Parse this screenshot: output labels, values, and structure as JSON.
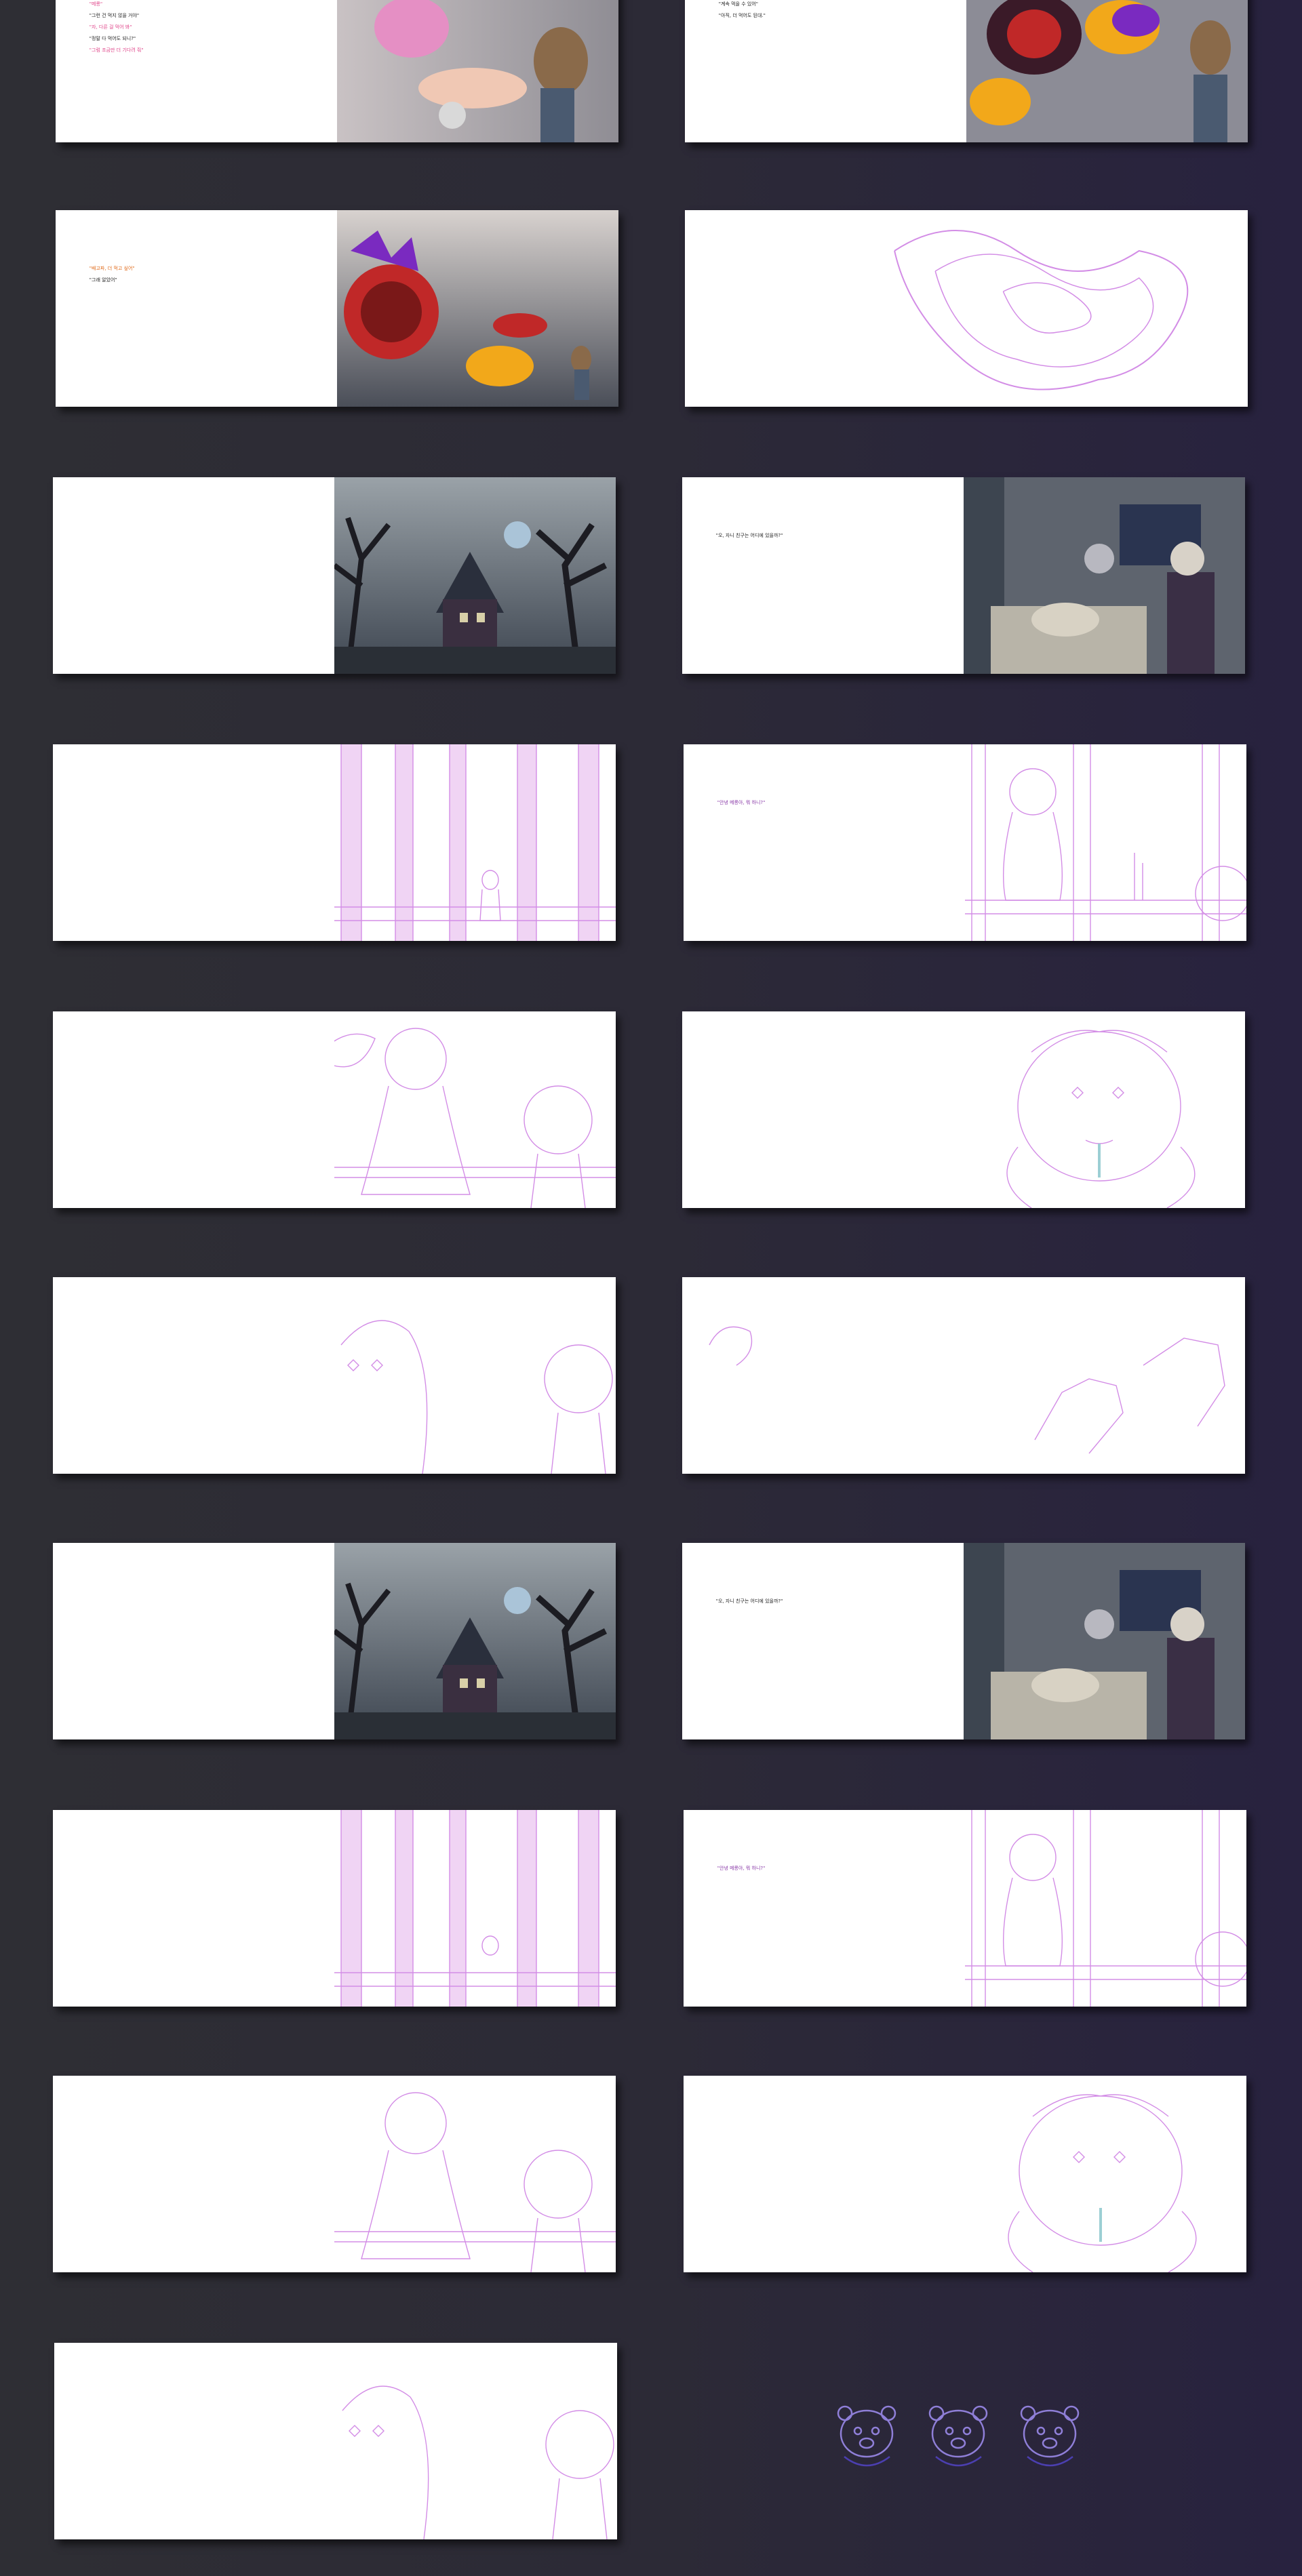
{
  "page": {
    "title": ""
  },
  "spreads": [
    {
      "id": "s01",
      "lines": [
        {
          "t": "\"메롱\"",
          "c": "pink"
        },
        {
          "t": "\"그런 건 먹지 않을 거야\"",
          "c": ""
        },
        {
          "t": "\"자, 다른 걸 먹어 봐\"",
          "c": "pink"
        },
        {
          "t": "",
          "c": ""
        },
        {
          "t": "\"정말 다 먹어도 되니?\"",
          "c": ""
        },
        {
          "t": "\"그럼 조금만 더 기다려 줘\"",
          "c": "pink"
        }
      ]
    },
    {
      "id": "s02",
      "lines": [
        {
          "t": "\"계속 먹을 수 있어\"",
          "c": ""
        },
        {
          "t": "\"아직, 더 먹어도 된대.\"",
          "c": ""
        },
        {
          "t": "",
          "c": ""
        }
      ]
    },
    {
      "id": "s03",
      "lines": [
        {
          "t": "\"배고파, 더 먹고 싶어\"",
          "c": "orange"
        },
        {
          "t": "",
          "c": ""
        },
        {
          "t": "\"그래 알았어\"",
          "c": ""
        }
      ]
    },
    {
      "id": "s04",
      "lines": [
        {
          "t": "",
          "c": ""
        }
      ]
    },
    {
      "id": "s05",
      "lines": [
        {
          "t": "",
          "c": ""
        }
      ]
    },
    {
      "id": "s06",
      "lines": [
        {
          "t": "\"오, 자니 친구는 어디에 있을까?\"",
          "c": ""
        },
        {
          "t": "",
          "c": ""
        },
        {
          "t": "",
          "c": ""
        }
      ]
    },
    {
      "id": "s07",
      "lines": [
        {
          "t": "",
          "c": ""
        }
      ]
    },
    {
      "id": "s08",
      "lines": [
        {
          "t": "\"안녕 메롱아, 뭐 하니?\"",
          "c": "purple"
        },
        {
          "t": "",
          "c": ""
        },
        {
          "t": "",
          "c": "purple"
        },
        {
          "t": "",
          "c": "purple"
        }
      ]
    },
    {
      "id": "s09",
      "lines": [
        {
          "t": "",
          "c": "purple"
        },
        {
          "t": "",
          "c": ""
        },
        {
          "t": "",
          "c": "purple"
        },
        {
          "t": "",
          "c": ""
        }
      ]
    },
    {
      "id": "s10",
      "lines": [
        {
          "t": "",
          "c": "purple"
        }
      ]
    },
    {
      "id": "s11",
      "lines": [
        {
          "t": "",
          "c": ""
        },
        {
          "t": "",
          "c": ""
        },
        {
          "t": "",
          "c": "pink"
        },
        {
          "t": "",
          "c": ""
        },
        {
          "t": "",
          "c": ""
        },
        {
          "t": "",
          "c": "purple"
        },
        {
          "t": "",
          "c": ""
        },
        {
          "t": "",
          "c": ""
        }
      ]
    },
    {
      "id": "s12",
      "lines": [
        {
          "t": "",
          "c": ""
        }
      ]
    },
    {
      "id": "s13",
      "lines": [
        {
          "t": "",
          "c": ""
        }
      ]
    },
    {
      "id": "s14",
      "lines": [
        {
          "t": "\"오, 자니 친구는 어디에 있을까?\"",
          "c": ""
        },
        {
          "t": "",
          "c": ""
        },
        {
          "t": "",
          "c": ""
        }
      ]
    },
    {
      "id": "s15",
      "lines": [
        {
          "t": "",
          "c": ""
        }
      ]
    },
    {
      "id": "s16",
      "lines": [
        {
          "t": "\"안녕 메롱아, 뭐 하니?\"",
          "c": "purple"
        },
        {
          "t": "",
          "c": ""
        },
        {
          "t": "",
          "c": "purple"
        },
        {
          "t": "",
          "c": "purple"
        }
      ]
    },
    {
      "id": "s17",
      "lines": [
        {
          "t": "",
          "c": "purple"
        },
        {
          "t": "",
          "c": ""
        },
        {
          "t": "",
          "c": "purple"
        },
        {
          "t": "",
          "c": ""
        }
      ]
    },
    {
      "id": "s18",
      "lines": [
        {
          "t": "",
          "c": "purple"
        }
      ]
    },
    {
      "id": "s19",
      "lines": [
        {
          "t": "",
          "c": ""
        },
        {
          "t": "",
          "c": ""
        },
        {
          "t": "",
          "c": "pink"
        },
        {
          "t": "",
          "c": ""
        },
        {
          "t": "",
          "c": ""
        },
        {
          "t": "",
          "c": "purple"
        },
        {
          "t": "",
          "c": ""
        },
        {
          "t": "",
          "c": ""
        }
      ]
    }
  ],
  "colors": {
    "pink": "#e0458a",
    "purple": "#8a3aa8",
    "orange": "#e06a1a",
    "sketch": "#d38de6",
    "dark_scene": "#3d4550"
  },
  "icons": [
    "bear-sticker-icon",
    "bear-sticker-icon",
    "bear-sticker-icon"
  ]
}
